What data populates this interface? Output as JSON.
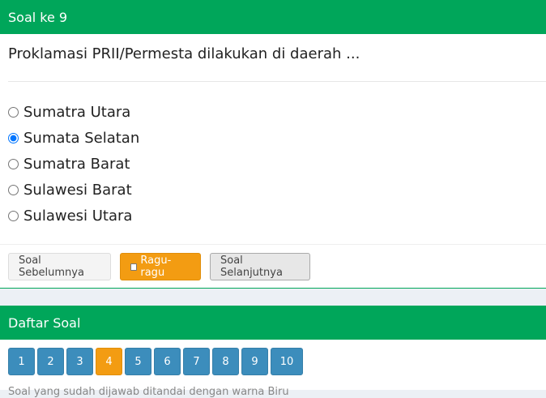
{
  "question_card": {
    "title": "Soal ke 9",
    "question": "Proklamasi PRII/Permesta dilakukan di daerah ...",
    "options": [
      "Sumatra Utara",
      "Sumata Selatan",
      "Sumatra Barat",
      "Sulawesi Barat",
      "Sulawesi Utara"
    ],
    "selected_option": "Sumata Selatan",
    "prev_label": "Soal Sebelumnya",
    "doubt_label": "Ragu-ragu",
    "next_label": "Soal Selanjutnya"
  },
  "nav_card": {
    "title": "Daftar Soal",
    "numbers": [
      "1",
      "2",
      "3",
      "4",
      "5",
      "6",
      "7",
      "8",
      "9",
      "10"
    ],
    "doubt_number": "4",
    "footnote": "Soal yang sudah dijawab ditandai dengan warna Biru"
  },
  "colors": {
    "header_green": "#00a65a",
    "answered_blue": "#3c8dbc",
    "doubt_orange": "#f39c12"
  }
}
